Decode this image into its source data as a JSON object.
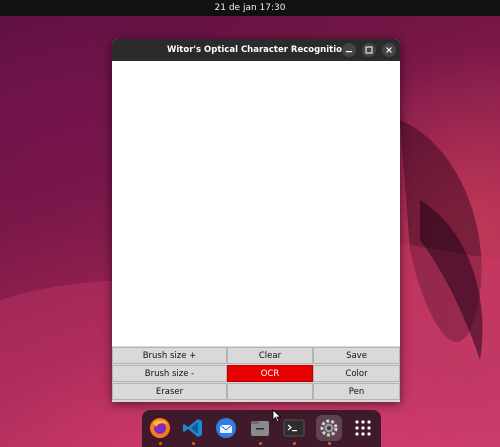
{
  "system": {
    "clock": "21 de jan  17:30"
  },
  "window": {
    "title": "Witor's Optical Character Recognition",
    "controls": {
      "minimize_icon": "minimize-icon",
      "maximize_icon": "maximize-icon",
      "close_icon": "close-icon"
    }
  },
  "buttons": {
    "brush_plus": "Brush size +",
    "clear": "Clear",
    "save": "Save",
    "brush_minus": "Brush size -",
    "ocr": "OCR",
    "color": "Color",
    "eraser": "Eraser",
    "pen": "Pen"
  },
  "colors": {
    "ocr_button": "#e60000",
    "titlebar": "#2b2b2b",
    "dock_indicator": "#e95420"
  },
  "dock": {
    "items": [
      {
        "icon": "firefox-icon"
      },
      {
        "icon": "vscode-icon"
      },
      {
        "icon": "thunderbird-icon"
      },
      {
        "icon": "files-icon"
      },
      {
        "icon": "terminal-icon"
      },
      {
        "icon": "settings-icon"
      },
      {
        "icon": "app-grid-icon"
      }
    ]
  }
}
